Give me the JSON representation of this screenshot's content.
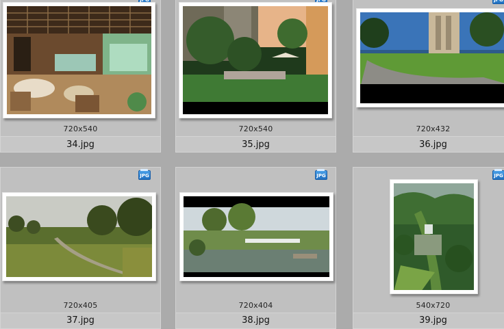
{
  "badge_label": "JPG",
  "files": [
    {
      "name": "34.jpg",
      "dimensions": "720x540",
      "scene": "interior-lounge"
    },
    {
      "name": "35.jpg",
      "dimensions": "720x540",
      "scene": "garden-villa"
    },
    {
      "name": "36.jpg",
      "dimensions": "720x432",
      "scene": "park-lawn"
    },
    {
      "name": "37.jpg",
      "dimensions": "720x405",
      "scene": "grass-path"
    },
    {
      "name": "38.jpg",
      "dimensions": "720x404",
      "scene": "waterfront"
    },
    {
      "name": "39.jpg",
      "dimensions": "540x720",
      "scene": "aerial-valley"
    }
  ]
}
